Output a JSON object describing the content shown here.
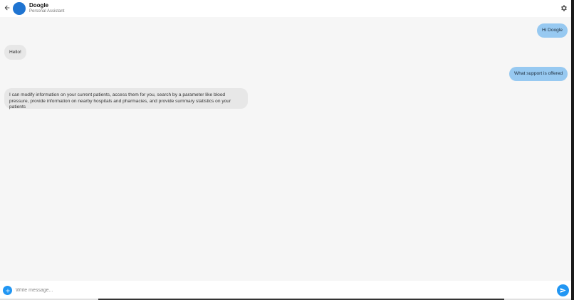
{
  "header": {
    "title": "Doogle",
    "subtitle": "Personal Assistant",
    "back_icon": "arrow-left-icon",
    "settings_icon": "gear-icon",
    "avatar_color": "#1f74d1"
  },
  "messages": [
    {
      "sender": "user",
      "text": "Hi Doogle"
    },
    {
      "sender": "bot",
      "text": "Hello!"
    },
    {
      "sender": "user",
      "text": "What support is offered"
    },
    {
      "sender": "bot",
      "text": "I can modify information on your current patients, access them for you, search by a parameter like blood pressure, provide information on nearby hospitals and pharmacies, and provide summary statistics on your patients"
    }
  ],
  "composer": {
    "placeholder": "Write message...",
    "add_icon": "plus-icon",
    "send_icon": "send-icon",
    "accent_color": "#2196f3"
  },
  "colors": {
    "user_bubble": "#97c9f1",
    "bot_bubble": "#e7e7e7",
    "background": "#f6f6f6"
  }
}
